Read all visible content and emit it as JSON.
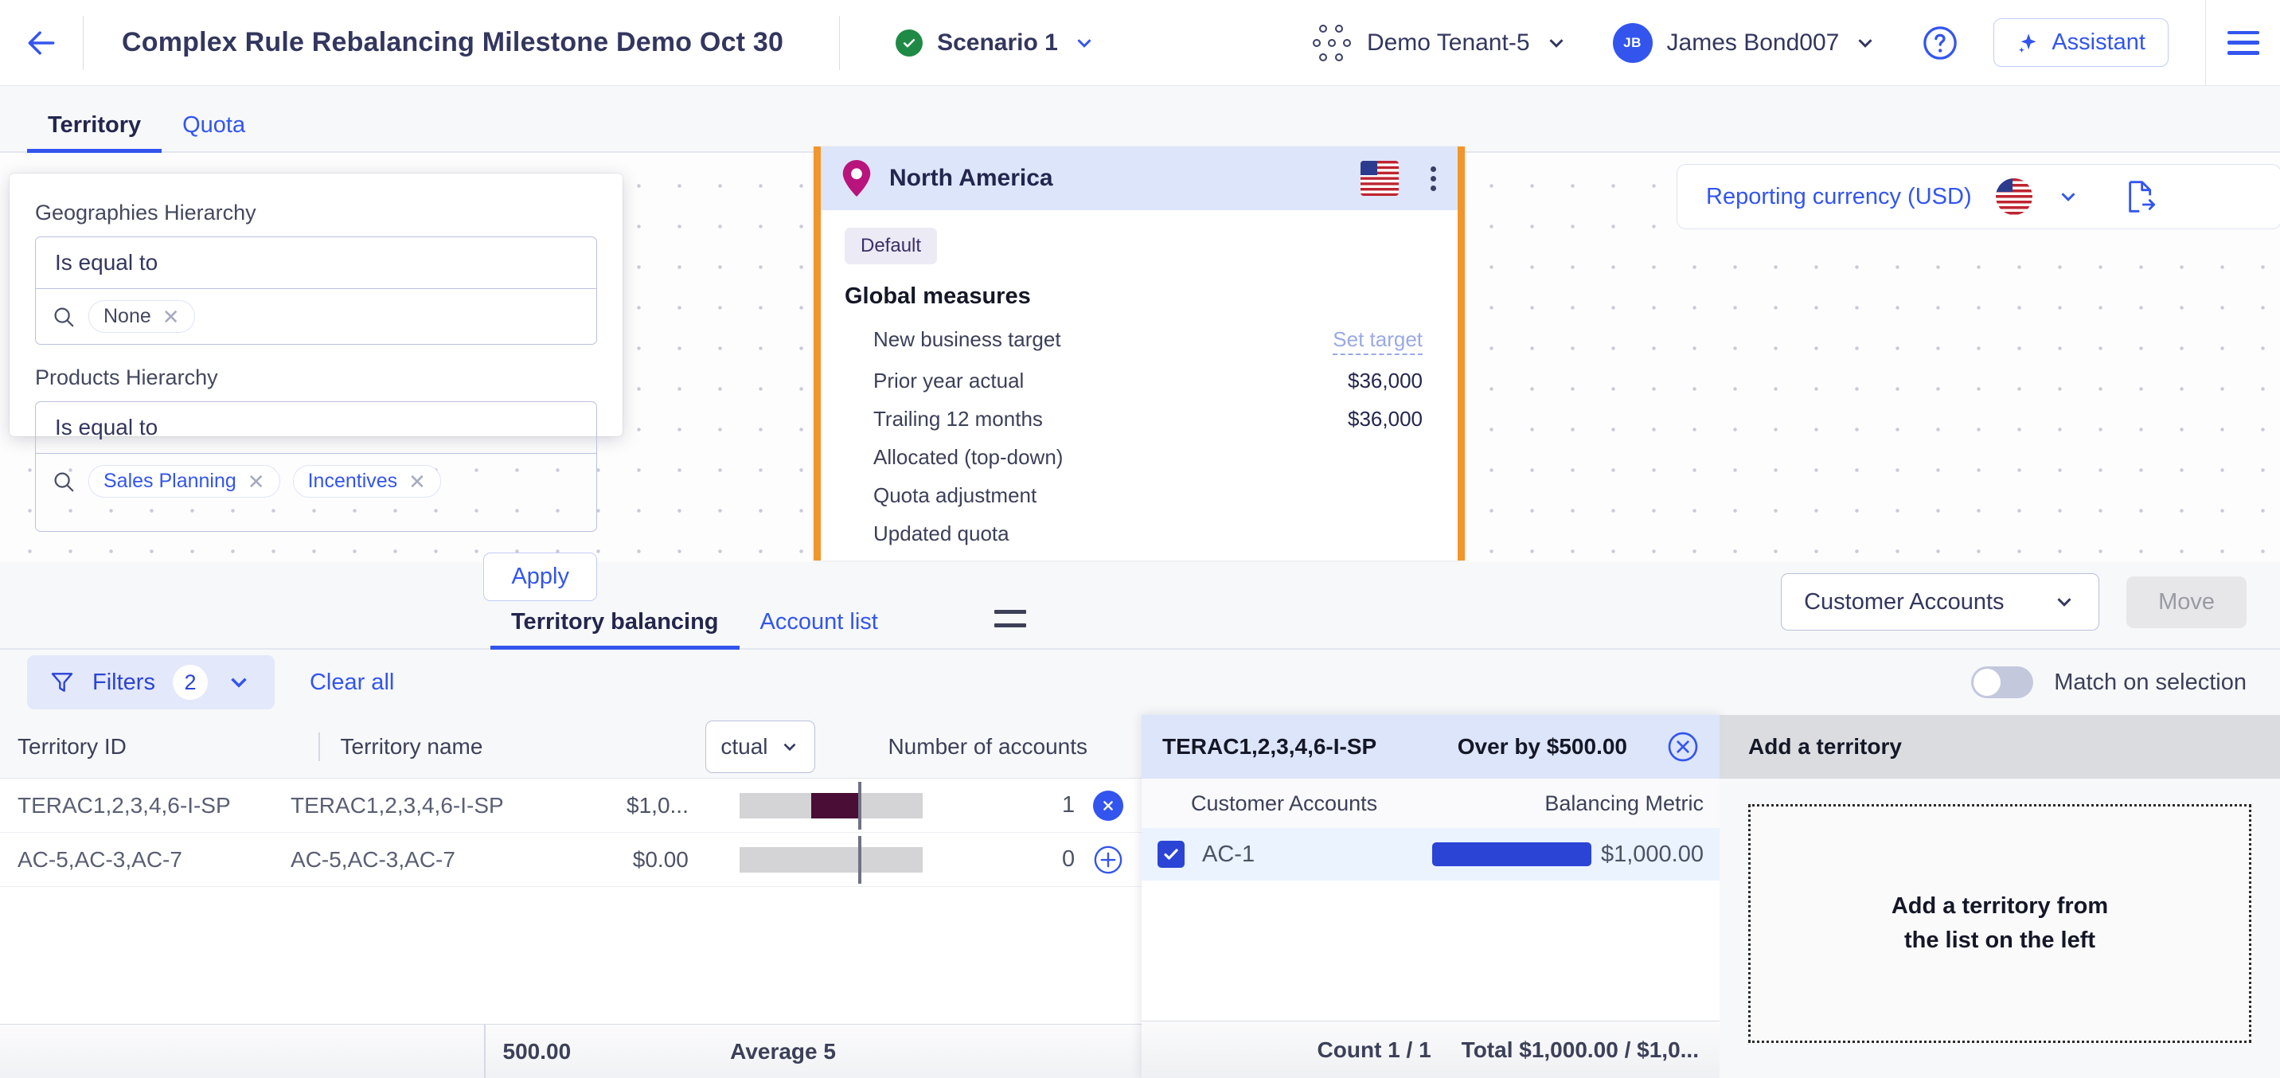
{
  "topbar": {
    "back_icon": "arrow-left-icon",
    "title": "Complex Rule Rebalancing Milestone Demo Oct 30",
    "scenario": {
      "label": "Scenario 1",
      "status_icon": "check-circle-icon"
    },
    "tenant": {
      "label": "Demo Tenant-5",
      "icon": "app-grid-icon"
    },
    "user": {
      "initials": "JB",
      "name": "James Bond007"
    },
    "help_icon": "question-circle-icon",
    "assistant": {
      "label": "Assistant",
      "icon": "sparkle-icon"
    },
    "menu_icon": "hamburger-menu-icon"
  },
  "tabs": [
    {
      "label": "Territory",
      "active": true
    },
    {
      "label": "Quota",
      "active": false
    }
  ],
  "filter_popover": {
    "groups": [
      {
        "label": "Geographies Hierarchy",
        "operator": "Is equal to",
        "tokens": [
          "None"
        ]
      },
      {
        "label": "Products Hierarchy",
        "operator": "Is equal to",
        "tokens": [
          "Sales Planning",
          "Incentives"
        ]
      }
    ],
    "apply_label": "Apply",
    "search_icon": "search-icon"
  },
  "territory_card": {
    "name": "North America",
    "pin_icon": "location-pin-icon",
    "flag_icon": "us-flag-icon",
    "menu_icon": "kebab-menu-icon",
    "badge": "Default",
    "section_title": "Global measures",
    "measures": [
      {
        "label": "New business target",
        "value": "Set target",
        "is_link": true
      },
      {
        "label": "Prior year actual",
        "value": "$36,000",
        "is_link": false
      },
      {
        "label": "Trailing 12 months",
        "value": "$36,000",
        "is_link": false
      },
      {
        "label": "Allocated (top-down)",
        "value": "",
        "is_link": false
      },
      {
        "label": "Quota adjustment",
        "value": "",
        "is_link": false
      },
      {
        "label": "Updated quota",
        "value": "",
        "is_link": false
      }
    ]
  },
  "reporting_currency": {
    "label": "Reporting currency (USD)",
    "flag_icon": "us-flag-round-icon",
    "chevron_icon": "chevron-down-icon",
    "export_icon": "file-export-icon"
  },
  "mid_toolbar": {
    "tabs": [
      {
        "label": "Territory balancing",
        "active": true
      },
      {
        "label": "Account list",
        "active": false
      }
    ],
    "drag_handle_icon": "equals-drag-handle-icon",
    "dimension_select": "Customer Accounts",
    "move_label": "Move"
  },
  "filters_row": {
    "filters_label": "Filters",
    "filters_count": "2",
    "funnel_icon": "funnel-icon",
    "chevron_icon": "chevron-down-icon",
    "clear_all": "Clear all",
    "match_label": "Match on selection",
    "match_on": false
  },
  "left_table": {
    "columns": [
      "Territory ID",
      "Territory name",
      "ctual",
      "Number of accounts"
    ],
    "actual_select": "ctual",
    "rows": [
      {
        "territory_id": "TERAC1,2,3,4,6-I-SP",
        "territory_name": "TERAC1,2,3,4,6-I-SP",
        "amount": "$1,0...",
        "accounts": "1",
        "action_icon": "remove-circle-icon",
        "bar_start_pct": 39,
        "bar_width_pct": 26
      },
      {
        "territory_id": "AC-5,AC-3,AC-7",
        "territory_name": "AC-5,AC-3,AC-7",
        "amount": "$0.00",
        "accounts": "0",
        "action_icon": "add-circle-icon",
        "bar_start_pct": 0,
        "bar_width_pct": 0
      }
    ],
    "footer": {
      "total": "500.00",
      "average": "Average 5"
    }
  },
  "center_panel": {
    "title": "TERAC1,2,3,4,6-I-SP",
    "over_by": "Over by $500.00",
    "close_icon": "close-circle-icon",
    "columns": [
      "Customer Accounts",
      "Balancing Metric"
    ],
    "rows": [
      {
        "checked": true,
        "account": "AC-1",
        "amount": "$1,000.00",
        "bar_pct": 100
      }
    ],
    "footer": {
      "count": "Count 1 / 1",
      "total": "Total $1,000.00 / $1,0..."
    }
  },
  "right_panel": {
    "title": "Add a territory",
    "dropzone_line1": "Add a territory from",
    "dropzone_line2": "the list on the left"
  },
  "colors": {
    "accent": "#3355ee",
    "accent_dark": "#2b44d6",
    "title": "#33365e",
    "card_border": "#f0962c",
    "bar_dark": "#4a0d35",
    "header_blue": "#dde5fb",
    "success": "#1f8a45"
  }
}
